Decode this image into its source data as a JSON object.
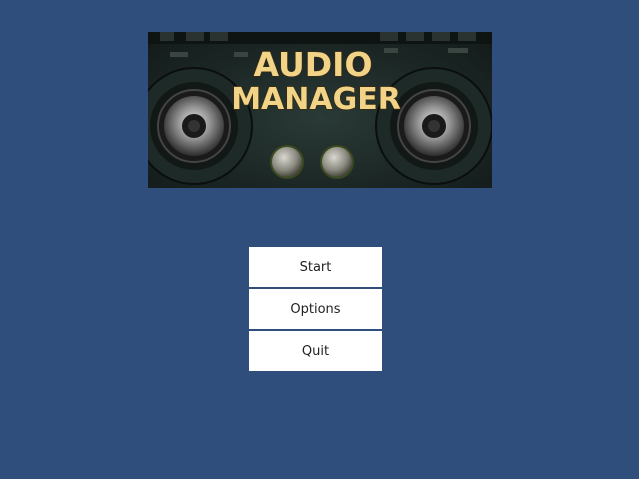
{
  "banner": {
    "title_line1": "AUDIO",
    "title_line2": "MANAGER"
  },
  "menu": {
    "start_label": "Start",
    "options_label": "Options",
    "quit_label": "Quit"
  },
  "colors": {
    "background": "#304e7b",
    "button_bg": "#ffffff",
    "button_text": "#222222",
    "title_fill": "#f2d488"
  }
}
